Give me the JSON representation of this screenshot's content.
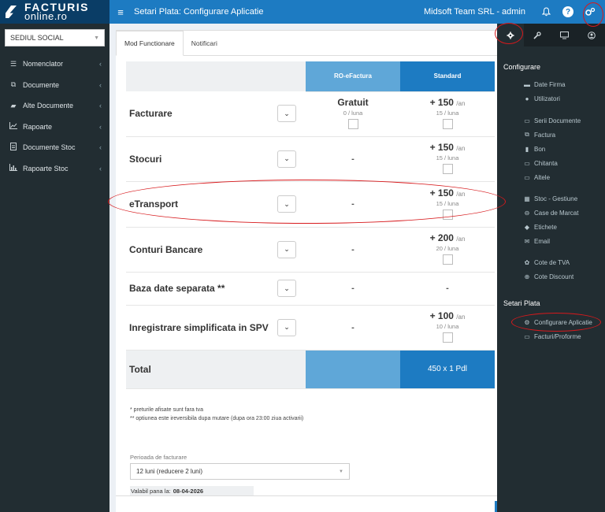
{
  "app": {
    "logo_line1": "FACTURIS",
    "logo_line2": "online.ro"
  },
  "header": {
    "menu_icon": "hamburger-icon",
    "title": "Setari Plata: Configurare Aplicatie",
    "company": "Midsoft Team SRL - admin",
    "icons": [
      "bell-icon",
      "help-icon",
      "cogs-icon"
    ]
  },
  "sidebar": {
    "select_value": "SEDIUL SOCIAL",
    "items": [
      {
        "label": "Nomenclator",
        "icon": "list-icon"
      },
      {
        "label": "Documente",
        "icon": "copy-icon"
      },
      {
        "label": "Alte Documente",
        "icon": "folder-icon"
      },
      {
        "label": "Rapoarte",
        "icon": "line-chart-icon"
      },
      {
        "label": "Documente Stoc",
        "icon": "file-icon"
      },
      {
        "label": "Rapoarte Stoc",
        "icon": "bar-chart-icon"
      }
    ]
  },
  "main": {
    "tabs": [
      {
        "label": "Mod Functionare",
        "active": true
      },
      {
        "label": "Notificari",
        "active": false
      }
    ],
    "plan_headers": [
      "RO-eFactura",
      "Standard"
    ],
    "features": [
      {
        "name": "Facturare",
        "ro": {
          "type": "price",
          "price": "Gratuit",
          "per": "",
          "sub": "0 / luna"
        },
        "std": {
          "type": "price",
          "price": "+ 150",
          "per": "/an",
          "sub": "15 / luna"
        }
      },
      {
        "name": "Stocuri",
        "ro": {
          "type": "dash",
          "text": "-"
        },
        "std": {
          "type": "price",
          "price": "+ 150",
          "per": "/an",
          "sub": "15 / luna"
        }
      },
      {
        "name": "eTransport",
        "ro": {
          "type": "dash",
          "text": "-"
        },
        "std": {
          "type": "price",
          "price": "+ 150",
          "per": "/an",
          "sub": "15 / luna"
        }
      },
      {
        "name": "Conturi Bancare",
        "ro": {
          "type": "dash",
          "text": "-"
        },
        "std": {
          "type": "price",
          "price": "+ 200",
          "per": "/an",
          "sub": "20 / luna"
        }
      },
      {
        "name": "Baza date separata **",
        "ro": {
          "type": "dash",
          "text": "-"
        },
        "std": {
          "type": "dash",
          "text": "-"
        }
      },
      {
        "name": "Inregistrare simplificata in SPV",
        "ro": {
          "type": "dash",
          "text": "-"
        },
        "std": {
          "type": "price",
          "price": "+ 100",
          "per": "/an",
          "sub": "10 / luna"
        }
      }
    ],
    "total_label": "Total",
    "total_value": "450 x 1 Pdl",
    "notes": [
      "* preturile afisate sunt fara tva",
      "** optiunea este ireversibila dupa mutare (dupa ora 23:00 ziua activarii)"
    ],
    "period_label": "Perioada de facturare",
    "period_value": "12 luni (reducere 2 luni)",
    "valid_label": "Valabil pana la:",
    "valid_date": "08-04-2026"
  },
  "right_panel": {
    "tabs": [
      "gear-icon",
      "wrench-icon",
      "monitor-icon",
      "user-circle-icon"
    ],
    "configurare_title": "Configurare",
    "configurare_items": [
      {
        "label": "Date Firma",
        "icon": "book-icon"
      },
      {
        "label": "Utilizatori",
        "icon": "user-icon"
      },
      {
        "label": "Serii Documente",
        "icon": "file-text-icon"
      },
      {
        "label": "Factura",
        "icon": "copy-icon"
      },
      {
        "label": "Bon",
        "icon": "receipt-icon"
      },
      {
        "label": "Chitanta",
        "icon": "file-text-icon"
      },
      {
        "label": "Altele",
        "icon": "file-text-icon"
      },
      {
        "label": "Stoc - Gestiune",
        "icon": "grid-icon"
      },
      {
        "label": "Case de Marcat",
        "icon": "cash-register-icon"
      },
      {
        "label": "Etichete",
        "icon": "tag-icon"
      },
      {
        "label": "Email",
        "icon": "envelope-icon"
      },
      {
        "label": "Cote de TVA",
        "icon": "percent-icon"
      },
      {
        "label": "Cote Discount",
        "icon": "search-icon"
      }
    ],
    "setari_title": "Setari Plata",
    "setari_items": [
      {
        "label": "Configurare Aplicatie",
        "icon": "cogs-icon"
      },
      {
        "label": "Facturi/Proforme",
        "icon": "credit-card-icon"
      }
    ]
  },
  "colors": {
    "header_blue": "#1d7bc2",
    "logo_bg": "#0a3d66",
    "sidebar_bg": "#222d32",
    "ro_col": "#5fa7d8",
    "std_col": "#1d7bc2",
    "annotation": "#d7191c"
  }
}
